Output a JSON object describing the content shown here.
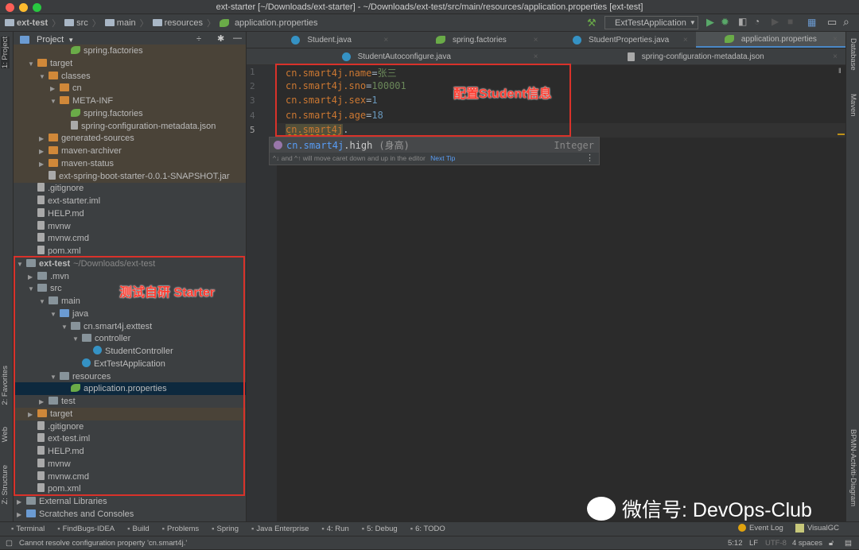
{
  "window": {
    "title": "ext-starter [~/Downloads/ext-starter] - ~/Downloads/ext-test/src/main/resources/application.properties [ext-test]"
  },
  "breadcrumb": [
    "ext-test",
    "src",
    "main",
    "resources",
    "application.properties"
  ],
  "toolbar": {
    "run_config": "ExtTestApplication"
  },
  "left_strip": {
    "project": "1: Project",
    "favorites": "2: Favorites",
    "web": "Web",
    "structure": "Z: Structure"
  },
  "right_strip": {
    "database": "Database",
    "maven": "Maven",
    "bpmn": "BPMN-Activiti-Diagram"
  },
  "project_panel": {
    "title": "Project"
  },
  "tree": [
    {
      "label": "spring.factories",
      "level": 4,
      "type": "spring",
      "excl": true
    },
    {
      "label": "target",
      "level": 1,
      "type": "orange",
      "expanded": true,
      "excl": true
    },
    {
      "label": "classes",
      "level": 2,
      "type": "orange",
      "expanded": true,
      "excl": true
    },
    {
      "label": "cn",
      "level": 3,
      "type": "orange",
      "expanded": false,
      "excl": true
    },
    {
      "label": "META-INF",
      "level": 3,
      "type": "orange",
      "expanded": true,
      "excl": true
    },
    {
      "label": "spring.factories",
      "level": 4,
      "type": "spring",
      "excl": true
    },
    {
      "label": "spring-configuration-metadata.json",
      "level": 4,
      "type": "file",
      "excl": true
    },
    {
      "label": "generated-sources",
      "level": 2,
      "type": "orange",
      "expanded": false,
      "excl": true
    },
    {
      "label": "maven-archiver",
      "level": 2,
      "type": "orange",
      "expanded": false,
      "excl": true
    },
    {
      "label": "maven-status",
      "level": 2,
      "type": "orange",
      "expanded": false,
      "excl": true
    },
    {
      "label": "ext-spring-boot-starter-0.0.1-SNAPSHOT.jar",
      "level": 2,
      "type": "file",
      "excl": true
    },
    {
      "label": ".gitignore",
      "level": 1,
      "type": "file"
    },
    {
      "label": "ext-starter.iml",
      "level": 1,
      "type": "file"
    },
    {
      "label": "HELP.md",
      "level": 1,
      "type": "file"
    },
    {
      "label": "mvnw",
      "level": 1,
      "type": "file"
    },
    {
      "label": "mvnw.cmd",
      "level": 1,
      "type": "file"
    },
    {
      "label": "pom.xml",
      "level": 1,
      "type": "file"
    },
    {
      "label": "ext-test",
      "hint": "~/Downloads/ext-test",
      "level": 0,
      "type": "mod",
      "expanded": true,
      "bold": true
    },
    {
      "label": ".mvn",
      "level": 1,
      "type": "folder",
      "expanded": false
    },
    {
      "label": "src",
      "level": 1,
      "type": "folder",
      "expanded": true
    },
    {
      "label": "main",
      "level": 2,
      "type": "folder",
      "expanded": true
    },
    {
      "label": "java",
      "level": 3,
      "type": "blue",
      "expanded": true
    },
    {
      "label": "cn.smart4j.exttest",
      "level": 4,
      "type": "folder",
      "expanded": true
    },
    {
      "label": "controller",
      "level": 5,
      "type": "folder",
      "expanded": true
    },
    {
      "label": "StudentController",
      "level": 6,
      "type": "class"
    },
    {
      "label": "ExtTestApplication",
      "level": 5,
      "type": "class"
    },
    {
      "label": "resources",
      "level": 3,
      "type": "folder",
      "expanded": true
    },
    {
      "label": "application.properties",
      "level": 4,
      "type": "spring",
      "selected": true
    },
    {
      "label": "test",
      "level": 2,
      "type": "folder",
      "expanded": false
    },
    {
      "label": "target",
      "level": 1,
      "type": "orange",
      "expanded": false,
      "excl": true
    },
    {
      "label": ".gitignore",
      "level": 1,
      "type": "file"
    },
    {
      "label": "ext-test.iml",
      "level": 1,
      "type": "file"
    },
    {
      "label": "HELP.md",
      "level": 1,
      "type": "file"
    },
    {
      "label": "mvnw",
      "level": 1,
      "type": "file"
    },
    {
      "label": "mvnw.cmd",
      "level": 1,
      "type": "file"
    },
    {
      "label": "pom.xml",
      "level": 1,
      "type": "file"
    },
    {
      "label": "External Libraries",
      "level": 0,
      "type": "folder",
      "expanded": false
    },
    {
      "label": "Scratches and Consoles",
      "level": 0,
      "type": "blue",
      "expanded": false
    }
  ],
  "tabs_row1": [
    {
      "label": "Student.java",
      "icon": "class"
    },
    {
      "label": "spring.factories",
      "icon": "spring"
    },
    {
      "label": "StudentProperties.java",
      "icon": "class"
    },
    {
      "label": "application.properties",
      "icon": "spring",
      "active": true
    }
  ],
  "tabs_row2": [
    {
      "label": "StudentAutoconfigure.java",
      "icon": "class"
    },
    {
      "label": "spring-configuration-metadata.json",
      "icon": "file"
    }
  ],
  "editor": {
    "lines": [
      {
        "key": "cn.smart4j.name",
        "eq": "=",
        "val": "张三",
        "vclass": "v"
      },
      {
        "key": "cn.smart4j.sno",
        "eq": "=",
        "val": "100001",
        "vclass": "v"
      },
      {
        "key": "cn.smart4j.sex",
        "eq": "=",
        "val": "1",
        "vclass": "n"
      },
      {
        "key": "cn.smart4j.age",
        "eq": "=",
        "val": "18",
        "vclass": "n"
      },
      {
        "key": "cn.smart4j",
        "eq": ".",
        "val": "",
        "vclass": "v"
      }
    ]
  },
  "annotations": {
    "config": "配置Student信息",
    "test": "测试自研 Starter"
  },
  "completion": {
    "prefix": "cn.smart4j",
    "rest": ".high",
    "desc": "(身高)",
    "type": "Integer",
    "tip": "^↓ and ^↑ will move caret down and up in the editor",
    "next_tip": "Next Tip"
  },
  "bottom_tools": [
    "Terminal",
    "FindBugs-IDEA",
    "Build",
    "Problems",
    "Spring",
    "Java Enterprise",
    "4: Run",
    "5: Debug",
    "6: TODO"
  ],
  "bottom_right": {
    "event_log": "Event Log",
    "visualgc": "VisualGC"
  },
  "status": {
    "message": "Cannot resolve configuration property 'cn.smart4j.'",
    "position": "5:12",
    "line_sep": "LF",
    "encoding": "UTF-8",
    "indent": "4 spaces"
  },
  "watermark": "微信号: DevOps-Club",
  "colors": {
    "accent": "#4a88c7",
    "annotation_red": "#d9322a",
    "selection": "#0d293e"
  }
}
